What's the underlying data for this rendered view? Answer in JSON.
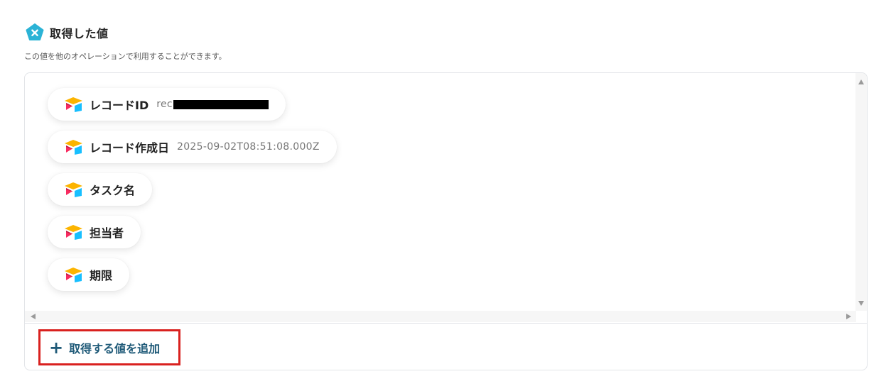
{
  "header": {
    "title": "取得した値",
    "description": "この値を他のオペレーションで利用することができます。",
    "icon": "yoom-x-icon",
    "icon_color": "#2bb3d6"
  },
  "values": [
    {
      "label": "レコードID",
      "value": "rec",
      "redacted": true
    },
    {
      "label": "レコード作成日",
      "value": "2025-09-02T08:51:08.000Z"
    },
    {
      "label": "タスク名",
      "value": ""
    },
    {
      "label": "担当者",
      "value": ""
    },
    {
      "label": "期限",
      "value": ""
    }
  ],
  "chip_icon": "airtable-icon",
  "add_button": {
    "label": "取得する値を追加",
    "icon": "+",
    "color": "#1f5a78",
    "highlight_color": "#d9211f"
  }
}
